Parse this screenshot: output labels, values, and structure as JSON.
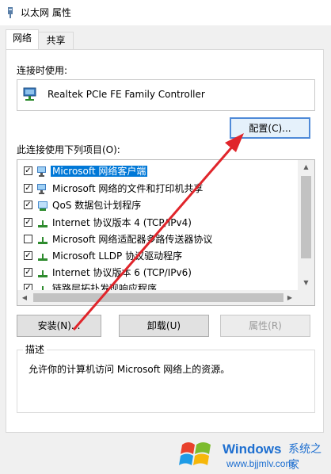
{
  "window": {
    "title": "以太网 属性",
    "close_label": ""
  },
  "tabs": [
    {
      "label": "网络",
      "active": true
    },
    {
      "label": "共享",
      "active": false
    }
  ],
  "connect_using": {
    "label": "连接时使用:",
    "adapter": "Realtek PCIe FE Family Controller",
    "configure_button": "配置(C)..."
  },
  "items_section": {
    "label": "此连接使用下列项目(O):",
    "items": [
      {
        "label": "Microsoft 网络客户端",
        "checked": true,
        "icon": "network-client-icon",
        "selected": true
      },
      {
        "label": "Microsoft 网络的文件和打印机共享",
        "checked": true,
        "icon": "file-printer-sharing-icon",
        "selected": false
      },
      {
        "label": "QoS 数据包计划程序",
        "checked": true,
        "icon": "service-icon",
        "selected": false
      },
      {
        "label": "Internet 协议版本 4 (TCP/IPv4)",
        "checked": true,
        "icon": "protocol-icon",
        "selected": false
      },
      {
        "label": "Microsoft 网络适配器多路传送器协议",
        "checked": false,
        "icon": "protocol-icon",
        "selected": false
      },
      {
        "label": "Microsoft LLDP 协议驱动程序",
        "checked": true,
        "icon": "protocol-icon",
        "selected": false
      },
      {
        "label": "Internet 协议版本 6 (TCP/IPv6)",
        "checked": true,
        "icon": "protocol-icon",
        "selected": false
      },
      {
        "label": "链路层拓扑发现响应程序",
        "checked": true,
        "icon": "protocol-icon",
        "selected": false
      }
    ]
  },
  "buttons": {
    "install": "安装(N)...",
    "uninstall": "卸载(U)",
    "properties": "属性(R)"
  },
  "description": {
    "title": "描述",
    "text": "允许你的计算机访问 Microsoft 网络上的资源。"
  },
  "watermark": {
    "brand": "Windows",
    "suffix": "系统之家",
    "url": "www.bjjmlv.com"
  },
  "colors": {
    "selection": "#0078d7",
    "annotation_arrow": "#e0252b",
    "watermark": "#1e6fd0"
  }
}
